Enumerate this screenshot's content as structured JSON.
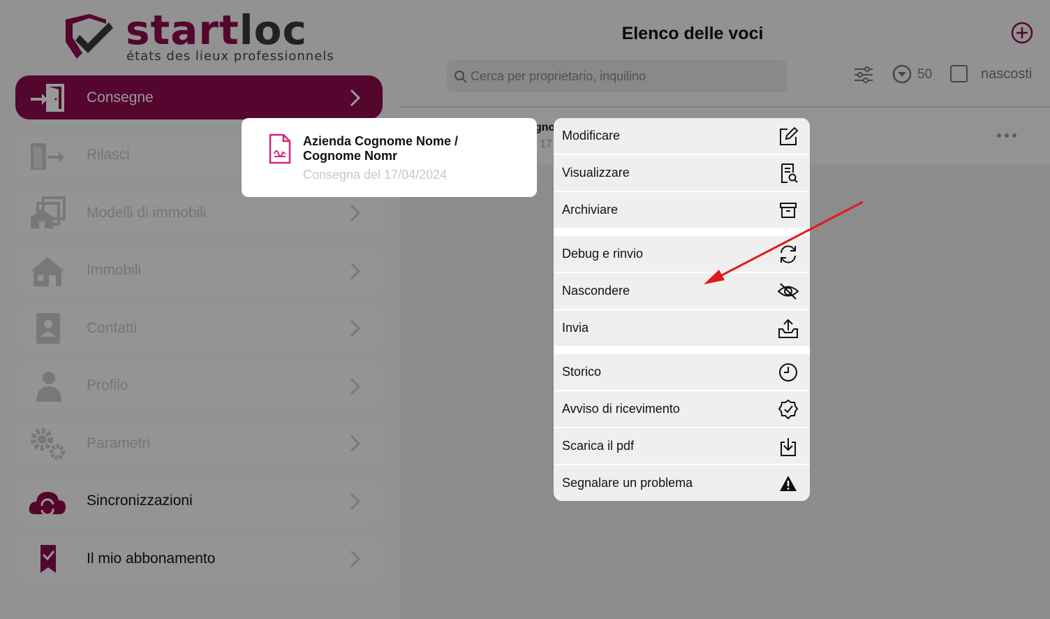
{
  "logo": {
    "word_a": "start",
    "word_b": "loc",
    "tagline": "états des lieux professionnels"
  },
  "sidebar": {
    "items": [
      {
        "label": "Consegne",
        "icon": "door-enter-icon"
      },
      {
        "label": "Rilasci",
        "icon": "door-exit-icon"
      },
      {
        "label": "Modelli di immobili",
        "icon": "property-models-icon"
      },
      {
        "label": "Immobili",
        "icon": "house-icon"
      },
      {
        "label": "Contatti",
        "icon": "contacts-icon"
      },
      {
        "label": "Profilo",
        "icon": "user-icon"
      },
      {
        "label": "Parametri",
        "icon": "gears-icon"
      },
      {
        "label": "Sincronizzazioni",
        "icon": "cloud-sync-icon"
      },
      {
        "label": "Il mio abbonamento",
        "icon": "bookmark-check-icon"
      }
    ]
  },
  "header": {
    "title": "Elenco delle voci",
    "search_placeholder": "Cerca per proprietario, inquilino",
    "count": "50",
    "hidden_label": "nascosti"
  },
  "list": {
    "row_fragment_title": "gno",
    "row_fragment_sub": "17"
  },
  "card": {
    "title": "Azienda Cognome Nome / Cognome Nomr",
    "subtitle": "Consegna del 17/04/2024"
  },
  "menu": {
    "items": [
      {
        "label": "Modificare",
        "icon": "edit-icon"
      },
      {
        "label": "Visualizzare",
        "icon": "view-document-icon"
      },
      {
        "label": "Archiviare",
        "icon": "archive-icon"
      },
      {
        "label": "Debug e rinvio",
        "icon": "sync-icon"
      },
      {
        "label": "Nascondere",
        "icon": "eye-off-icon"
      },
      {
        "label": "Invia",
        "icon": "upload-tray-icon"
      },
      {
        "label": "Storico",
        "icon": "clock-icon"
      },
      {
        "label": "Avviso di ricevimento",
        "icon": "badge-check-icon"
      },
      {
        "label": "Scarica il pdf",
        "icon": "download-icon"
      },
      {
        "label": "Segnalare un problema",
        "icon": "warning-icon"
      }
    ]
  },
  "colors": {
    "brand": "#8c0b4f",
    "annotation_arrow": "#e21a1a",
    "overlay": "rgba(0,0,0,0.4)"
  }
}
